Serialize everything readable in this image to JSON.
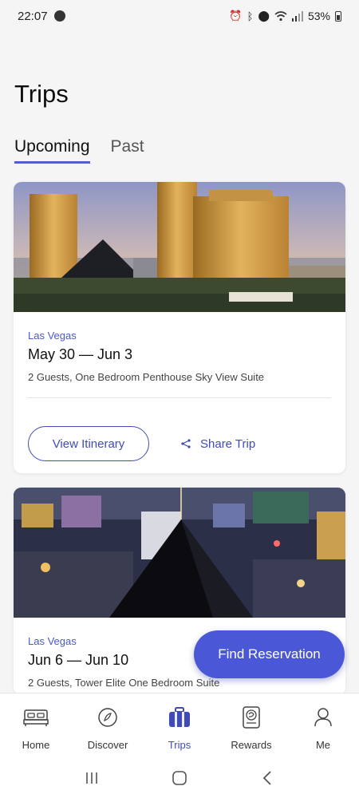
{
  "status_bar": {
    "time": "22:07",
    "battery": "53%"
  },
  "page": {
    "title": "Trips"
  },
  "tabs": [
    {
      "label": "Upcoming",
      "active": true
    },
    {
      "label": "Past",
      "active": false
    }
  ],
  "trips": [
    {
      "city": "Las Vegas",
      "dates": "May 30 — Jun 3",
      "room": "2 Guests, One Bedroom Penthouse Sky View Suite",
      "itinerary_label": "View Itinerary",
      "share_label": "Share Trip",
      "image": "mandalay-bay-hotel-photo"
    },
    {
      "city": "Las Vegas",
      "dates": "Jun 6 — Jun 10",
      "room": "2 Guests, Tower Elite One Bedroom Suite",
      "image": "luxor-pyramid-night-photo"
    }
  ],
  "fab": {
    "label": "Find Reservation"
  },
  "bottom_nav": [
    {
      "label": "Home",
      "icon": "bed-icon",
      "active": false
    },
    {
      "label": "Discover",
      "icon": "compass-icon",
      "active": false
    },
    {
      "label": "Trips",
      "icon": "suitcase-icon",
      "active": true
    },
    {
      "label": "Rewards",
      "icon": "rewards-card-icon",
      "active": false
    },
    {
      "label": "Me",
      "icon": "person-icon",
      "active": false
    }
  ],
  "colors": {
    "accent": "#4a57d6",
    "link": "#3f4bb8",
    "background": "#f5f5f6"
  }
}
